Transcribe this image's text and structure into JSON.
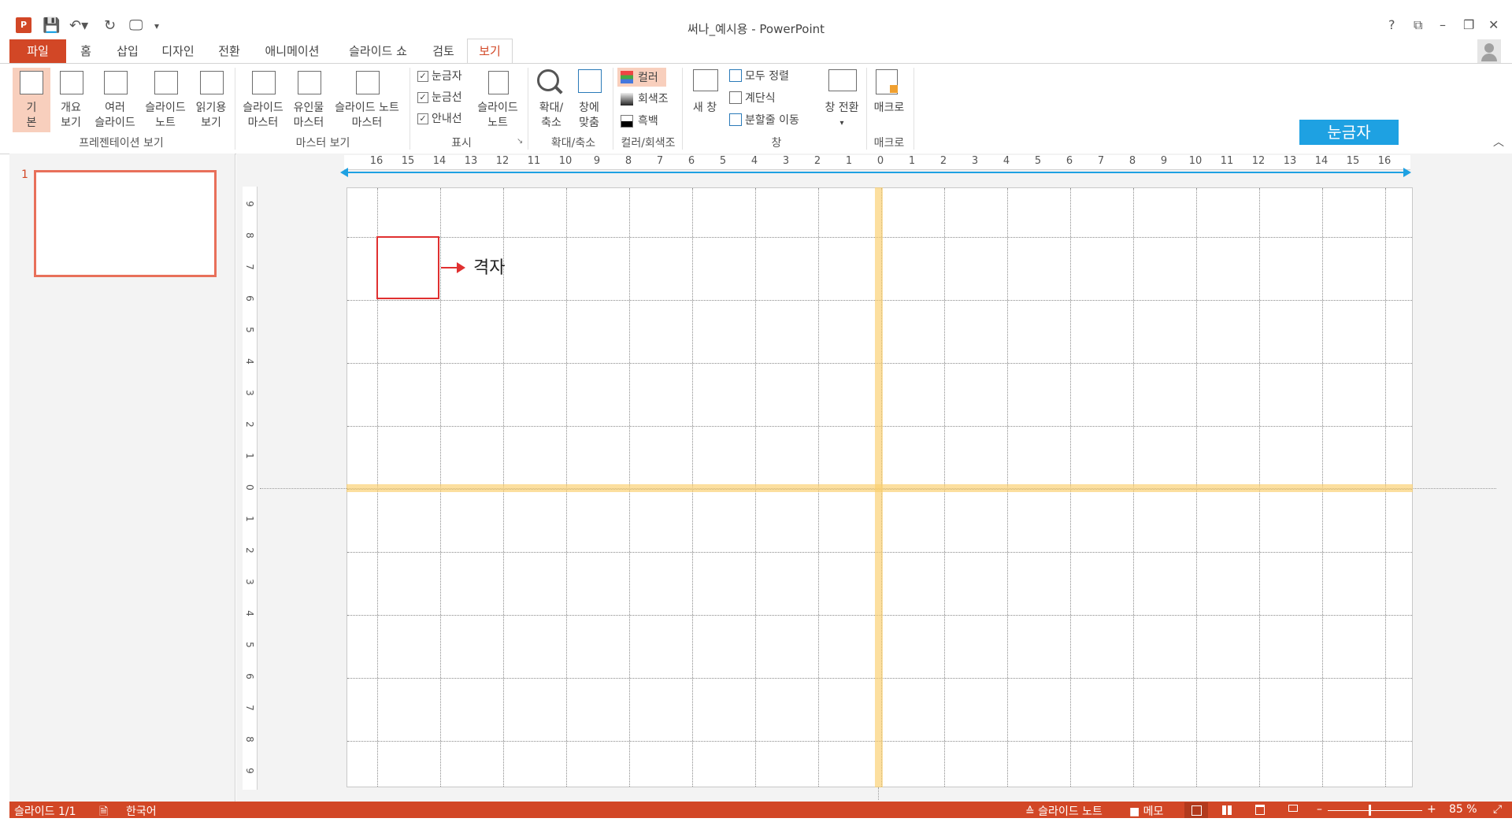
{
  "window": {
    "title": "써나_예시용 - PowerPoint",
    "help": "?",
    "restore_ribbon": "⧉",
    "minimize": "–",
    "maximize": "❐",
    "close": "✕"
  },
  "quick_access": {
    "app_icon": "P",
    "save": "💾",
    "undo": "↶▾",
    "redo": "↻",
    "present": "🖵",
    "customize": "▾"
  },
  "tabs": [
    "파일",
    "홈",
    "삽입",
    "디자인",
    "전환",
    "애니메이션",
    "슬라이드 쇼",
    "검토",
    "보기"
  ],
  "ribbon": {
    "presentation_views": {
      "group_label": "프레젠테이션 보기",
      "normal_l1": "기",
      "normal_l2": "본",
      "outline_l1": "개요",
      "outline_l2": "보기",
      "sorter_l1": "여러",
      "sorter_l2": "슬라이드",
      "notes_l1": "슬라이드",
      "notes_l2": "노트",
      "reading_l1": "읽기용",
      "reading_l2": "보기"
    },
    "master_views": {
      "group_label": "마스터 보기",
      "slide_master_l1": "슬라이드",
      "slide_master_l2": "마스터",
      "handout_master_l1": "유인물",
      "handout_master_l2": "마스터",
      "notes_master_l1": "슬라이드 노트",
      "notes_master_l2": "마스터"
    },
    "show": {
      "group_label": "표시",
      "ruler": "눈금자",
      "gridlines": "눈금선",
      "guides": "안내선",
      "notes_l1": "슬라이드",
      "notes_l2": "노트",
      "check": "✓",
      "launcher": "↘"
    },
    "zoom": {
      "group_label": "확대/축소",
      "zoom_l1": "확대/",
      "zoom_l2": "축소",
      "fit_l1": "창에",
      "fit_l2": "맞춤"
    },
    "color": {
      "group_label": "컬러/회색조",
      "color": "컬러",
      "grayscale": "회색조",
      "bw": "흑백"
    },
    "window": {
      "group_label": "창",
      "new_window": "새 창",
      "arrange_all": "모두 정렬",
      "cascade": "계단식",
      "move_split": "분할줄 이동",
      "switch_l1": "창 전환",
      "switch_l2": "▾"
    },
    "macros": {
      "group_label": "매크로",
      "macros": "매크로"
    },
    "collapse": "︿"
  },
  "annotation": {
    "ruler_badge": "눈금자",
    "grid_label": "격자"
  },
  "thumbnails": {
    "slide_number": "1"
  },
  "rulers": {
    "horizontal": [
      "16",
      "15",
      "14",
      "13",
      "12",
      "11",
      "10",
      "9",
      "8",
      "7",
      "6",
      "5",
      "4",
      "3",
      "2",
      "1",
      "0",
      "1",
      "2",
      "3",
      "4",
      "5",
      "6",
      "7",
      "8",
      "9",
      "10",
      "11",
      "12",
      "13",
      "14",
      "15",
      "16"
    ],
    "vertical": [
      "9",
      "8",
      "7",
      "6",
      "5",
      "4",
      "3",
      "2",
      "1",
      "0",
      "1",
      "2",
      "3",
      "4",
      "5",
      "6",
      "7",
      "8",
      "9"
    ]
  },
  "status": {
    "slide_count": "슬라이드 1/1",
    "spell_icon": "🗎",
    "language": "한국어",
    "notes": "≙ 슬라이드 노트",
    "comments": "■ 메모",
    "zoom_minus": "–",
    "zoom_plus": "+",
    "zoom_level": "85 %",
    "fit": "⤢"
  },
  "colors": {
    "accent": "#d24726",
    "ruler_badge": "#1ea1e2",
    "guide": "#face6c",
    "annotation_red": "#e03030",
    "thumb_border": "#e8705a"
  }
}
